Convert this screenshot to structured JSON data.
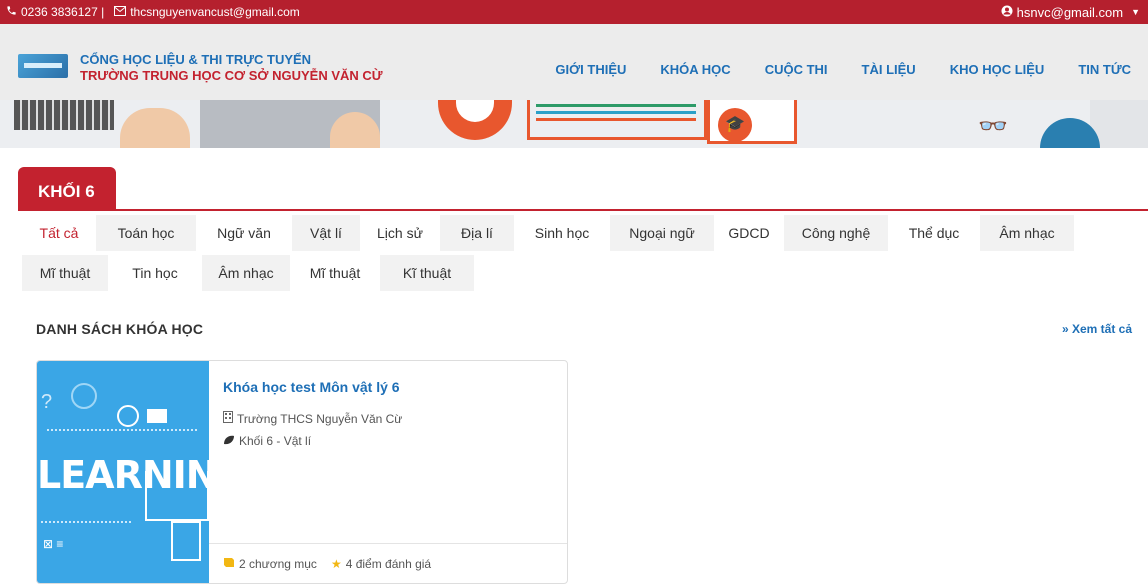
{
  "topbar": {
    "phone": "0236 3836127 |",
    "email": "thcsnguyenvancust@gmail.com",
    "user": "hsnvc@gmail.com",
    "icons": [
      "phone-icon",
      "envelope-icon",
      "user-circle-icon",
      "caret-down-icon"
    ]
  },
  "header": {
    "brand_line1": "CỔNG HỌC LIỆU & THI TRỰC TUYẾN",
    "brand_line2": "TRƯỜNG TRUNG HỌC CƠ SỞ NGUYỄN VĂN CỪ",
    "nav": [
      "GIỚI THIỆU",
      "KHÓA HỌC",
      "CUỘC THI",
      "TÀI LIỆU",
      "KHO HỌC LIỆU",
      "TIN TỨC"
    ]
  },
  "grade": {
    "label": "KHỐI 6"
  },
  "subjects": {
    "row1": [
      "Tất cả",
      "Toán học",
      "Ngữ văn",
      "Vật lí",
      "Lịch sử",
      "Địa lí",
      "Sinh học",
      "Ngoại ngữ",
      "GDCD",
      "Công nghệ",
      "Thể dục",
      "Âm nhạc"
    ],
    "row2": [
      "Mĩ thuật",
      "Tin học",
      "Âm nhạc",
      "Mĩ thuật",
      "Kĩ thuật"
    ],
    "active": "Tất cả"
  },
  "course_list": {
    "title": "DANH SÁCH KHÓA HỌC",
    "view_all": "» Xem tất cả",
    "courses": [
      {
        "title": "Khóa học test Môn vật lý 6",
        "school": "Trường THCS Nguyễn Văn Cừ",
        "grade_subject": "Khối 6 - Vật lí",
        "chapters": "2 chương mục",
        "rating": "4 điểm đánh giá",
        "thumbnail_text": "LEARNIN"
      }
    ]
  },
  "colors": {
    "brand_red": "#b5202e",
    "link_blue": "#1e6fb6",
    "tab_bg": "#f2f2f2"
  }
}
